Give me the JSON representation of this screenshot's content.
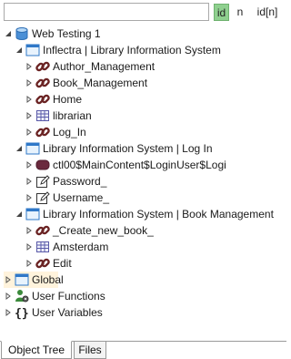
{
  "search": {
    "value": "",
    "placeholder": ""
  },
  "modes": {
    "id": "id",
    "n": "n",
    "idn": "id[n]"
  },
  "tree": {
    "root": "Web Testing 1",
    "page1": {
      "label": "Inflectra | Library Information System",
      "items": [
        "Author_Management",
        "Book_Management",
        "Home",
        "librarian",
        "Log_In"
      ]
    },
    "page2": {
      "label": "Library Information System | Log In",
      "items": [
        "ctl00$MainContent$LoginUser$Logi",
        "Password_",
        "Username_"
      ]
    },
    "page3": {
      "label": "Library Information System | Book Management",
      "items": [
        "_Create_new_book_",
        "Amsterdam",
        "Edit"
      ]
    },
    "global": "Global",
    "user_functions": "User Functions",
    "user_variables": "User Variables"
  },
  "tabs": {
    "object_tree": "Object Tree",
    "files": "Files"
  },
  "colors": {
    "active_mode": "#8fd08f",
    "selected_row": "#fff3dc",
    "link_icon": "#7b2a2a",
    "folder": "#4a8fd6"
  },
  "icons": {
    "root": "database-icon",
    "page": "window-icon",
    "link": "link-chain-icon",
    "table": "table-grid-icon",
    "button": "button-icon",
    "textbox": "edit-pencil-icon",
    "folder": "folder-icon",
    "functions": "person-gear-icon",
    "variables": "braces-icon"
  }
}
